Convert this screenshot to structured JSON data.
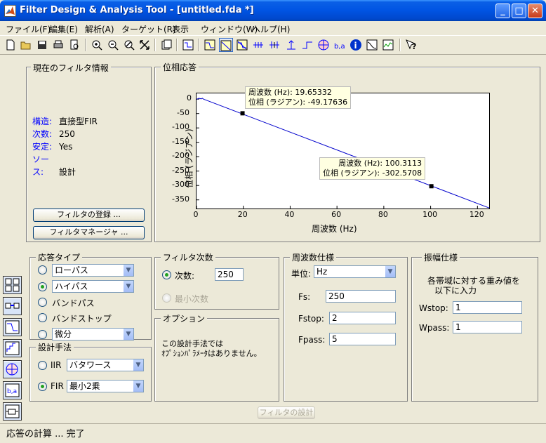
{
  "window": {
    "title": "Filter Design & Analysis Tool -  [untitled.fda *]",
    "min_glyph": "_",
    "max_glyph": "□",
    "close_glyph": "✕"
  },
  "menu": [
    "ファイル(F)",
    "編集(E)",
    "解析(A)",
    "ターゲット(R)",
    "表示",
    "ウィンドウ(W)",
    "ヘルプ(H)"
  ],
  "current_filter": {
    "title": "現在のフィルタ情報",
    "rows": [
      {
        "key": "構造:",
        "value": "直接型FIR"
      },
      {
        "key": "次数:",
        "value": "250"
      },
      {
        "key": "安定:",
        "value": "Yes"
      },
      {
        "key": "ソース:",
        "value": "設計"
      }
    ],
    "register_button": "フィルタの登録 ...",
    "manager_button": "フィルタマネージャ ..."
  },
  "plot_panel": {
    "title": "位相応答"
  },
  "chart_data": {
    "type": "line",
    "title": "",
    "xlabel": "周波数 (Hz)",
    "ylabel": "位相 (ラジアン)",
    "xlim": [
      0,
      125
    ],
    "ylim": [
      -380,
      20
    ],
    "x_ticks": [
      0,
      20,
      40,
      60,
      80,
      100,
      120
    ],
    "y_ticks": [
      0,
      -50,
      -100,
      -150,
      -200,
      -250,
      -300,
      -350
    ],
    "series": [
      {
        "x": [
          0,
          1,
          2,
          2.5,
          3,
          125
        ],
        "y": [
          -1,
          3,
          1,
          3,
          0,
          -378
        ]
      }
    ],
    "markers": [
      {
        "x": 19.65332,
        "y": -49.17636,
        "lines": [
          "周波数 (Hz): 19.65332",
          "位相 (ラジアン): -49.17636"
        ]
      },
      {
        "x": 100.3113,
        "y": -302.5708,
        "lines": [
          "周波数 (Hz): 100.3113",
          "位相 (ラジアン): -302.5708"
        ]
      }
    ],
    "line_color": "#0000cc"
  },
  "response_type": {
    "title": "応答タイプ",
    "lowpass": "ローパス",
    "highpass": "ハイパス",
    "bandpass": "バンドパス",
    "bandstop": "バンドストップ",
    "differentiator": "微分"
  },
  "design_method": {
    "title": "設計手法",
    "iir_label": "IIR",
    "iir_value": "バタワース",
    "fir_label": "FIR",
    "fir_value": "最小2乗"
  },
  "filter_order": {
    "title": "フィルタ次数",
    "specify_label": "次数:",
    "order_value": "250",
    "minimum_label": "最小次数"
  },
  "options": {
    "title": "オプション",
    "line1": "この設計手法では",
    "line2": "ｵﾌﾟｼｮﾝﾊﾟﾗﾒｰﾀはありません。"
  },
  "freq_spec": {
    "title": "周波数仕様",
    "units_label": "単位:",
    "units_value": "Hz",
    "fs_label": "Fs:",
    "fs_value": "250",
    "fstop_label": "Fstop:",
    "fstop_value": "2",
    "fpass_label": "Fpass:",
    "fpass_value": "5"
  },
  "mag_spec": {
    "title": "振幅仕様",
    "desc1": "各帯域に対する重み値を",
    "desc2": "以下に入力",
    "wstop_label": "Wstop:",
    "wstop_value": "1",
    "wpass_label": "Wpass:",
    "wpass_value": "1"
  },
  "design_button": "フィルタの設計",
  "status": "応答の計算 ... 完了"
}
